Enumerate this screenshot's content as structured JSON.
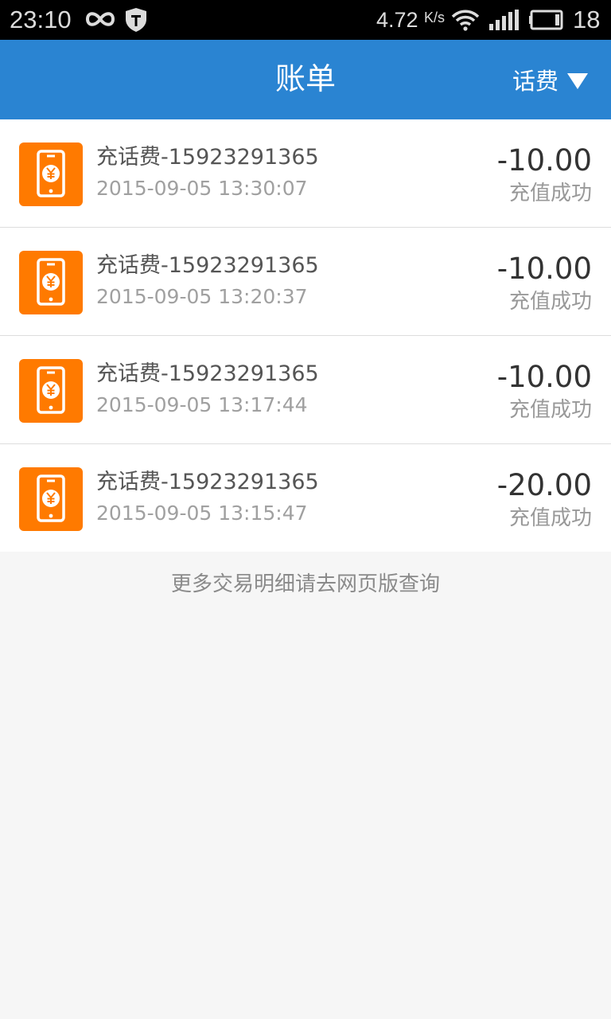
{
  "status_bar": {
    "time": "23:10",
    "net_speed": "4.72",
    "net_speed_unit": "K/s",
    "battery_level": "18",
    "icons": [
      "infinity-icon",
      "shield-icon",
      "wifi-icon",
      "signal-icon",
      "battery-icon"
    ]
  },
  "header": {
    "title": "账单",
    "filter_label": "话费"
  },
  "colors": {
    "header_bg": "#2a84d2",
    "icon_bg": "#ff7a00",
    "page_bg": "#f6f6f6"
  },
  "transactions": [
    {
      "title": "充话费-15923291365",
      "time": "2015-09-05 13:30:07",
      "amount": "-10.00",
      "status": "充值成功",
      "icon": "phone-recharge-icon"
    },
    {
      "title": "充话费-15923291365",
      "time": "2015-09-05 13:20:37",
      "amount": "-10.00",
      "status": "充值成功",
      "icon": "phone-recharge-icon"
    },
    {
      "title": "充话费-15923291365",
      "time": "2015-09-05 13:17:44",
      "amount": "-10.00",
      "status": "充值成功",
      "icon": "phone-recharge-icon"
    },
    {
      "title": "充话费-15923291365",
      "time": "2015-09-05 13:15:47",
      "amount": "-20.00",
      "status": "充值成功",
      "icon": "phone-recharge-icon"
    }
  ],
  "footer_note": "更多交易明细请去网页版查询"
}
